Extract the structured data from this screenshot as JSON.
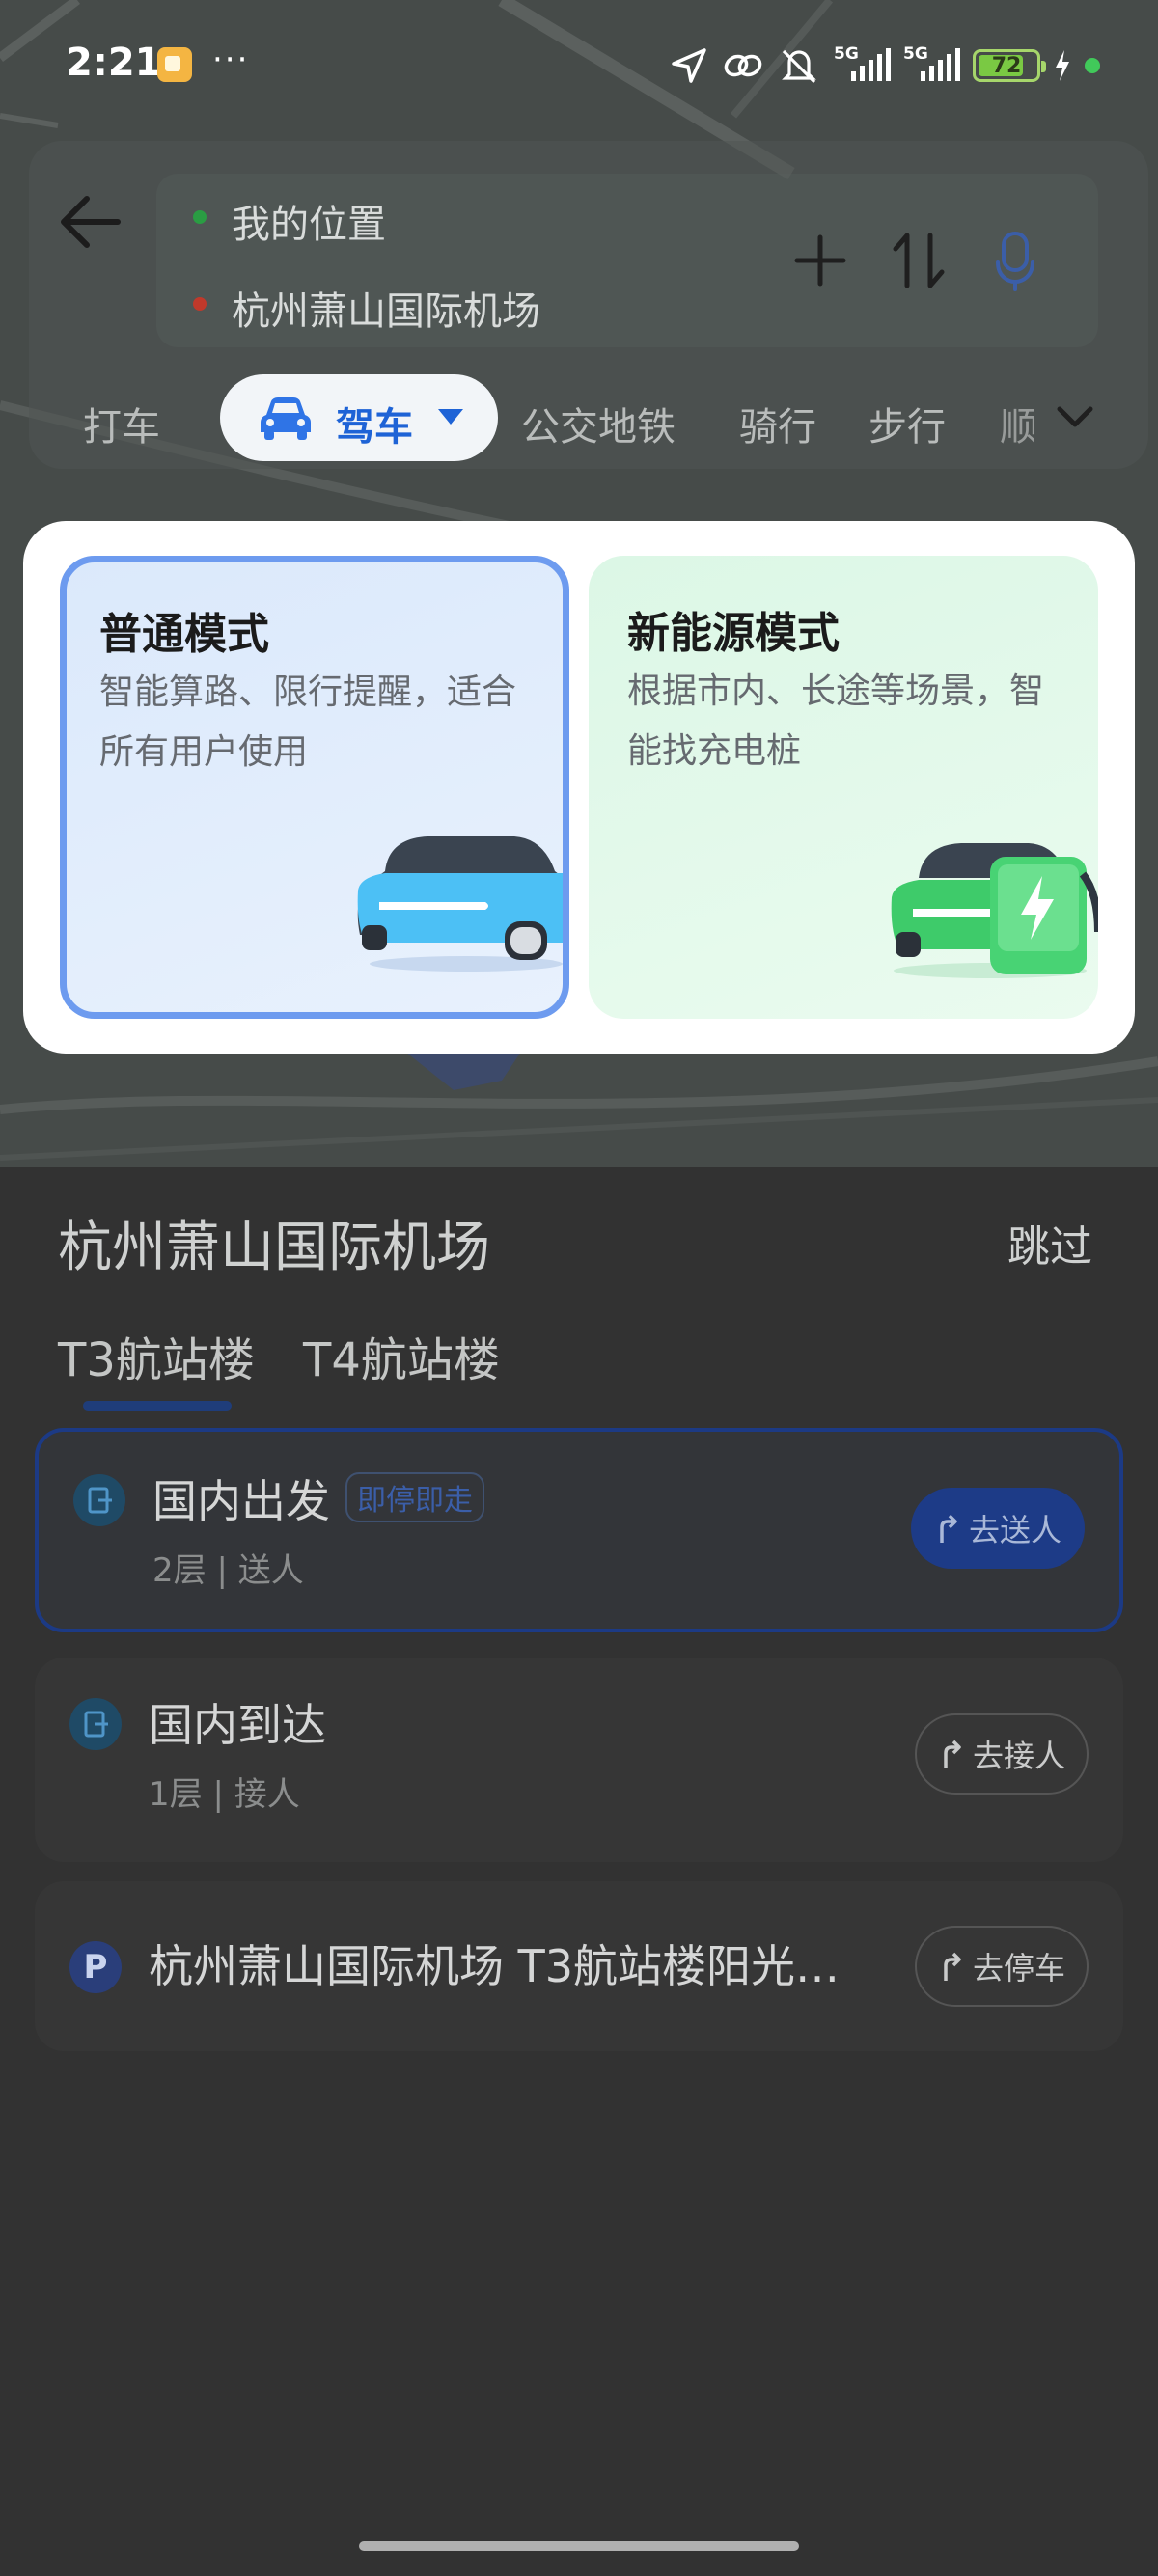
{
  "status_bar": {
    "time": "2:21",
    "more": "···",
    "net1": "5G",
    "net2": "5G",
    "battery": "72"
  },
  "route": {
    "origin": "我的位置",
    "destination": "杭州萧山国际机场"
  },
  "modes": {
    "taxi": "打车",
    "drive": "驾车",
    "transit": "公交地铁",
    "bike": "骑行",
    "walk": "步行",
    "ride": "顺"
  },
  "mode_popup": {
    "normal": {
      "title": "普通模式",
      "desc": "智能算路、限行提醒，适合所有用户使用"
    },
    "ev": {
      "title": "新能源模式",
      "desc": "根据市内、长途等场景，智能找充电桩"
    }
  },
  "airport": {
    "title": "杭州萧山国际机场",
    "skip": "跳过",
    "tabs": [
      "T3航站楼",
      "T4航站楼"
    ],
    "items": [
      {
        "title": "国内出发",
        "tag": "即停即走",
        "sub": "2层 | 送人",
        "action": "去送人"
      },
      {
        "title": "国内到达",
        "sub": "1层 | 接人",
        "action": "去接人"
      },
      {
        "title": "杭州萧山国际机场 T3航站楼阳光…",
        "action": "去停车"
      }
    ]
  },
  "colors": {
    "accent": "#1e63d6",
    "selected_border": "#6d9bef",
    "ev_green": "#41c95a"
  }
}
